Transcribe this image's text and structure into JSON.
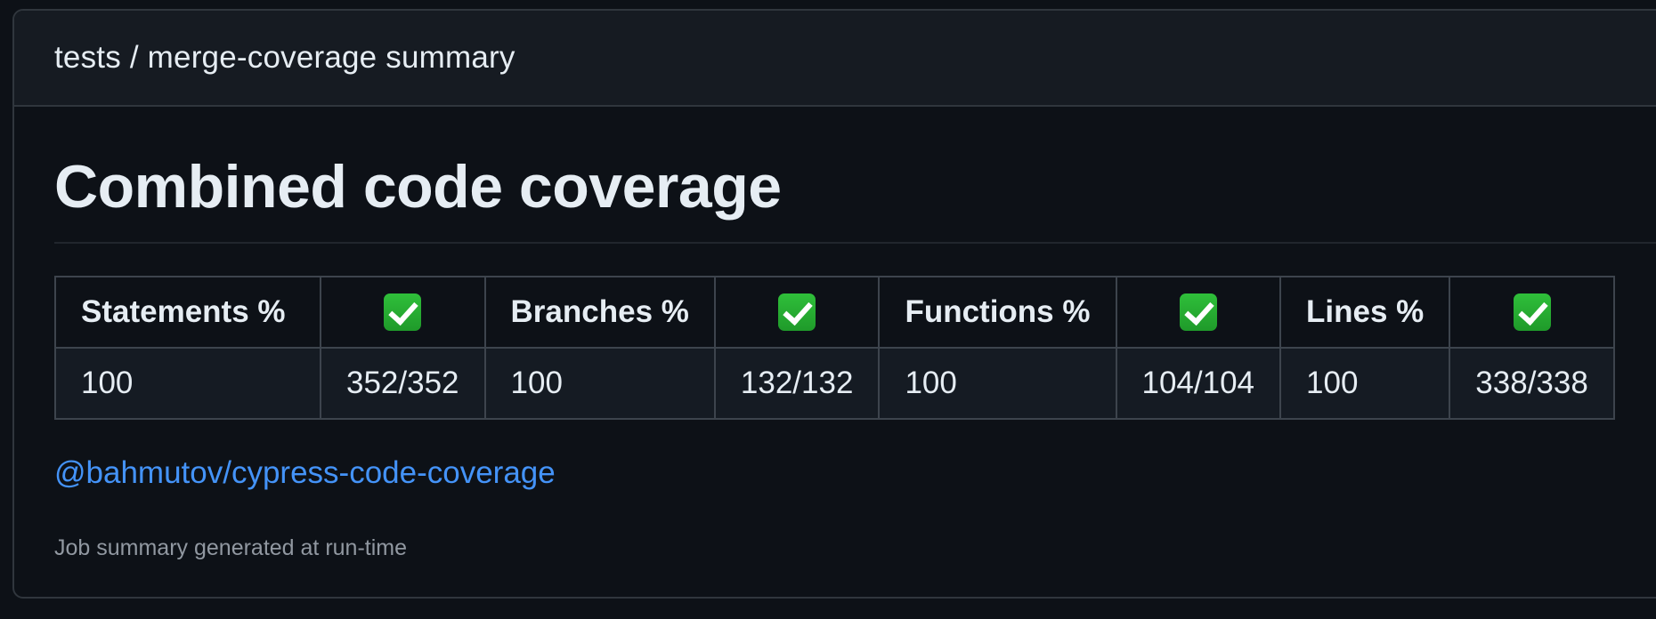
{
  "header": {
    "title": "tests / merge-coverage summary"
  },
  "main": {
    "heading": "Combined code coverage",
    "table": {
      "headers": [
        {
          "label": "Statements %",
          "badge": "check-mark-icon"
        },
        {
          "label": "Branches %",
          "badge": "check-mark-icon"
        },
        {
          "label": "Functions %",
          "badge": "check-mark-icon"
        },
        {
          "label": "Lines %",
          "badge": "check-mark-icon"
        }
      ],
      "row": [
        {
          "percent": "100",
          "covered": "352/352"
        },
        {
          "percent": "100",
          "covered": "132/132"
        },
        {
          "percent": "100",
          "covered": "104/104"
        },
        {
          "percent": "100",
          "covered": "338/338"
        }
      ]
    },
    "link_text": "@bahmutov/cypress-code-coverage",
    "footer_note": "Job summary generated at run-time"
  },
  "colors": {
    "background": "#0d1117",
    "header_bg": "#161b22",
    "border": "#30363d",
    "link": "#4493f8",
    "muted_text": "#9198a1",
    "check_green": "#2fbf3a"
  }
}
